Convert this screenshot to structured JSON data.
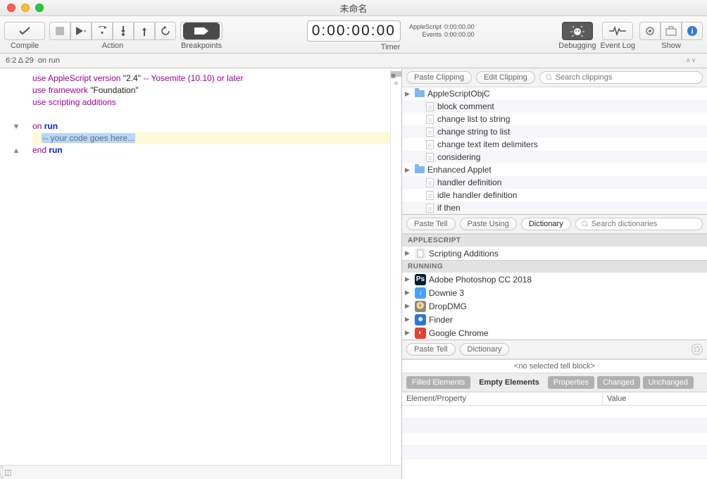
{
  "window": {
    "title": "未命名"
  },
  "toolbar": {
    "compile": "Compile",
    "action": "Action",
    "breakpoints": "Breakpoints",
    "timer": "Timer",
    "debugging": "Debugging",
    "eventlog": "Event Log",
    "show": "Show"
  },
  "timer": {
    "display": "0:00:00:00",
    "applescript_label": "AppleScript",
    "applescript_value": "0:00:00.00",
    "events_label": "Events",
    "events_value": "0:00:00.00"
  },
  "status": {
    "coords": "6:2 Δ 29",
    "context": "on run"
  },
  "clippings": {
    "paste": "Paste Clipping",
    "edit": "Edit Clipping",
    "search_placeholder": "Search clippings",
    "items": [
      {
        "type": "folder",
        "label": "AppleScriptObjC"
      },
      {
        "type": "doc",
        "label": "block comment"
      },
      {
        "type": "doc",
        "label": "change list to string"
      },
      {
        "type": "doc",
        "label": "change string to list"
      },
      {
        "type": "doc",
        "label": "change text item delimiters"
      },
      {
        "type": "doc",
        "label": "considering"
      },
      {
        "type": "folder",
        "label": "Enhanced Applet"
      },
      {
        "type": "doc",
        "label": "handler definition"
      },
      {
        "type": "doc",
        "label": "idle handler definition"
      },
      {
        "type": "doc",
        "label": "if then"
      }
    ]
  },
  "dictionary": {
    "paste_tell": "Paste Tell",
    "paste_using": "Paste Using",
    "dictionary": "Dictionary",
    "search_placeholder": "Search dictionaries",
    "section_applescript": "APPLESCRIPT",
    "scripting_additions": "Scripting Additions",
    "section_running": "RUNNING",
    "apps": [
      {
        "label": "Adobe Photoshop CC 2018",
        "icon": "Ps",
        "color": "#001e36"
      },
      {
        "label": "Downie 3",
        "icon": "↓",
        "color": "#4aa0ff"
      },
      {
        "label": "DropDMG",
        "icon": "📀",
        "color": "#888"
      },
      {
        "label": "Finder",
        "icon": "☻",
        "color": "#2c76d8"
      },
      {
        "label": "Google Chrome",
        "icon": "◐",
        "color": "#e34133"
      }
    ]
  },
  "vars": {
    "paste_tell": "Paste Tell",
    "dictionary": "Dictionary",
    "no_block": "<no selected tell block>",
    "tabs": {
      "filled": "Filled Elements",
      "empty": "Empty Elements",
      "properties": "Properties",
      "changed": "Changed",
      "unchanged": "Unchanged"
    },
    "col1": "Element/Property",
    "col2": "Value"
  },
  "code": {
    "l1a": "use",
    "l1b": "AppleScript",
    "l1c": "version",
    "l1d": "\"2.4\"",
    "l1e": "-- Yosemite (10.10) or later",
    "l2a": "use",
    "l2b": "framework",
    "l2c": "\"Foundation\"",
    "l3a": "use",
    "l3b": "scripting additions",
    "l5a": "on",
    "l5b": "run",
    "l6a": "-- your code goes here...",
    "l7a": "end",
    "l7b": "run"
  }
}
